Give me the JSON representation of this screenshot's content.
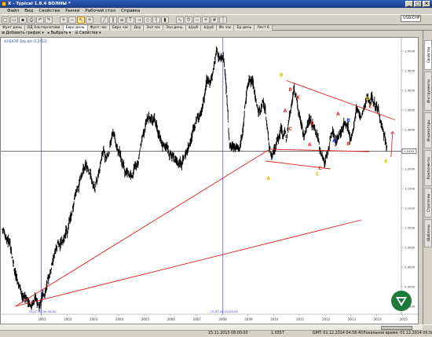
{
  "window": {
    "title": "X - Typical 1.8.4 ВОЛНЫ *"
  },
  "menu": [
    "Файл",
    "Вид",
    "Свойства",
    "Рынки",
    "Рабочий стол",
    "Справка"
  ],
  "toolbar": {
    "buttons": [
      "new",
      "open",
      "save",
      "print",
      "undo",
      "redo",
      "zoom-in",
      "zoom-out",
      "cursor",
      "crosshair",
      "line",
      "channel",
      "fib",
      "text",
      "arrow",
      "shapes",
      "bar-chart",
      "candle-chart",
      "line-chart",
      "timeframe",
      "minus",
      "plus",
      "grid",
      "period-sep"
    ],
    "symbol": "USD/CHF"
  },
  "tabs": [
    "Фунт день",
    "ВД Альтернатива",
    "Евро день",
    "Фунт час",
    "Евро час",
    "Доу",
    "Зол час",
    "Зол день",
    "$/руб",
    "$/руб",
    "Йе час",
    "Бр день",
    "Лест 6"
  ],
  "active_tab": 2,
  "chart_toolbar": {
    "add": "Добавить график",
    "select": "Выбрать",
    "props": "Свойства"
  },
  "chart_legend": "$USDCHF Day bar (1.2453)",
  "side_tabs": [
    "Свойства",
    "Инструменты",
    "Индикаторы",
    "Компоненты",
    "Стратегии",
    "Шаблоны"
  ],
  "status": {
    "cursor_date": "15.11.2013 08:00:00",
    "cursor_value": "1.0357",
    "gmt": "GMT: 01.12.2014 04:58:40",
    "local": "Локальное время: 01.12.2014 06:58:40"
  },
  "chart_data": {
    "type": "bar",
    "symbol": "USD/CHF",
    "current_price": "1.2453",
    "y_ticks": [
      "1.5000",
      "1.4500",
      "1.4000",
      "1.3500",
      "1.3000",
      "1.2500",
      "1.2000",
      "1.1500",
      "1.1000",
      "1.0500",
      "1.0000",
      "0.9500",
      "0.9000",
      "0.8500"
    ],
    "x_ticks": [
      "2001",
      "2002",
      "2003",
      "2004",
      "2005",
      "2006",
      "2007",
      "2008",
      "2009",
      "2010",
      "2011",
      "2012",
      "2013",
      "2014",
      "2015"
    ],
    "ylim": [
      0.83,
      1.53
    ],
    "vertical_markers": [
      {
        "date": "03.07.01 00:00:00",
        "year": 2001.5,
        "color": "#4040d0"
      },
      {
        "date": "15.07.08 00:00:00",
        "year": 2008.54,
        "color": "#4040d0"
      }
    ],
    "price_path": [
      [
        2000.0,
        1.047
      ],
      [
        2000.3,
        1.02
      ],
      [
        2000.5,
        0.94
      ],
      [
        2000.8,
        0.87
      ],
      [
        2001.0,
        0.862
      ],
      [
        2001.3,
        0.875
      ],
      [
        2001.5,
        0.86
      ],
      [
        2001.8,
        0.92
      ],
      [
        2002.0,
        0.98
      ],
      [
        2002.4,
        1.02
      ],
      [
        2002.7,
        1.09
      ],
      [
        2003.0,
        1.17
      ],
      [
        2003.3,
        1.21
      ],
      [
        2003.6,
        1.15
      ],
      [
        2003.9,
        1.24
      ],
      [
        2004.1,
        1.23
      ],
      [
        2004.3,
        1.28
      ],
      [
        2004.6,
        1.22
      ],
      [
        2004.9,
        1.18
      ],
      [
        2005.2,
        1.22
      ],
      [
        2005.6,
        1.32
      ],
      [
        2005.9,
        1.33
      ],
      [
        2006.2,
        1.27
      ],
      [
        2006.5,
        1.24
      ],
      [
        2006.8,
        1.21
      ],
      [
        2007.1,
        1.24
      ],
      [
        2007.4,
        1.31
      ],
      [
        2007.7,
        1.35
      ],
      [
        2007.9,
        1.41
      ],
      [
        2008.1,
        1.43
      ],
      [
        2008.3,
        1.49
      ],
      [
        2008.5,
        1.49
      ],
      [
        2008.6,
        1.47
      ],
      [
        2008.8,
        1.27
      ],
      [
        2009.0,
        1.25
      ],
      [
        2009.2,
        1.27
      ],
      [
        2009.5,
        1.42
      ],
      [
        2009.7,
        1.43
      ],
      [
        2009.9,
        1.35
      ],
      [
        2010.1,
        1.36
      ],
      [
        2010.2,
        1.33
      ],
      [
        2010.4,
        1.22
      ],
      [
        2010.6,
        1.26
      ],
      [
        2010.8,
        1.31
      ],
      [
        2011.0,
        1.28
      ],
      [
        2011.1,
        1.35
      ],
      [
        2011.3,
        1.41
      ],
      [
        2011.5,
        1.33
      ],
      [
        2011.7,
        1.28
      ],
      [
        2011.9,
        1.34
      ],
      [
        2012.1,
        1.3
      ],
      [
        2012.3,
        1.25
      ],
      [
        2012.45,
        1.22
      ],
      [
        2012.6,
        1.24
      ],
      [
        2012.8,
        1.31
      ],
      [
        2012.9,
        1.27
      ],
      [
        2013.1,
        1.3
      ],
      [
        2013.3,
        1.32
      ],
      [
        2013.5,
        1.27
      ],
      [
        2013.7,
        1.34
      ],
      [
        2013.9,
        1.33
      ],
      [
        2014.1,
        1.36
      ],
      [
        2014.3,
        1.39
      ],
      [
        2014.5,
        1.37
      ],
      [
        2014.6,
        1.35
      ],
      [
        2014.75,
        1.29
      ],
      [
        2014.9,
        1.245
      ]
    ],
    "trendlines": [
      {
        "from": [
          2000.5,
          0.85
        ],
        "to": [
          2010.35,
          1.25
        ]
      },
      {
        "from": [
          2000.5,
          0.85
        ],
        "to": [
          2013.9,
          1.07
        ]
      },
      {
        "from": [
          2010.2,
          1.22
        ],
        "to": [
          2012.7,
          1.2
        ]
      },
      {
        "from": [
          2010.4,
          1.25
        ],
        "to": [
          2014.2,
          1.244
        ]
      },
      {
        "from": [
          2011.0,
          1.425
        ],
        "to": [
          2015.2,
          1.325
        ]
      }
    ],
    "support_line": 1.2453,
    "wave_labels": [
      {
        "text": "B",
        "year": 2010.8,
        "value": 1.435,
        "color": "#d8c000"
      },
      {
        "text": "B",
        "year": 2011.15,
        "value": 1.398,
        "color": "#e03030"
      },
      {
        "text": "X",
        "year": 2011.45,
        "value": 1.378,
        "color": "#e03030"
      },
      {
        "text": "A",
        "year": 2010.95,
        "value": 1.344,
        "color": "#e03030"
      },
      {
        "text": "C",
        "year": 2011.15,
        "value": 1.298,
        "color": "#e03030"
      },
      {
        "text": "B",
        "year": 2012.0,
        "value": 1.312,
        "color": "#e03030"
      },
      {
        "text": "A",
        "year": 2011.9,
        "value": 1.258,
        "color": "#e03030"
      },
      {
        "text": "A",
        "year": 2010.3,
        "value": 1.172,
        "color": "#d8c000"
      },
      {
        "text": "C",
        "year": 2012.2,
        "value": 1.183,
        "color": "#d8c000"
      },
      {
        "text": "C",
        "year": 2012.3,
        "value": 1.198,
        "color": "#e03030"
      },
      {
        "text": "A",
        "year": 2013.0,
        "value": 1.336,
        "color": "#e03030"
      },
      {
        "text": "B",
        "year": 2013.4,
        "value": 1.32,
        "color": "#2040d0"
      },
      {
        "text": "A",
        "year": 2012.85,
        "value": 1.268,
        "color": "#2040d0"
      },
      {
        "text": "B",
        "year": 2013.4,
        "value": 1.26,
        "color": "#e03030"
      },
      {
        "text": "D",
        "year": 2014.15,
        "value": 1.375,
        "color": "#d8c000"
      },
      {
        "text": "C",
        "year": 2014.25,
        "value": 1.355,
        "color": "#e03030"
      },
      {
        "text": "E",
        "year": 2014.85,
        "value": 1.215,
        "color": "#d8c000"
      }
    ]
  }
}
